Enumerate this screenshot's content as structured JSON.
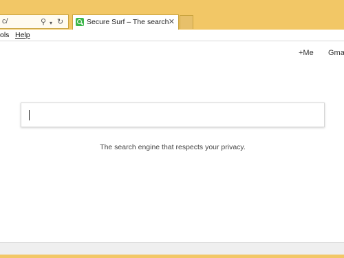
{
  "browser": {
    "address_url": "c/",
    "address_icons": [
      "search-icon",
      "dropdown-arrow-icon",
      "refresh-icon"
    ],
    "tab": {
      "title": "Secure Surf – The search en...",
      "close_glyph": "✕"
    },
    "menu": {
      "tools_partial": "ols",
      "help": "Help"
    }
  },
  "page": {
    "header_links": [
      "+Me",
      "Gma"
    ],
    "search": {
      "value": "",
      "placeholder": ""
    },
    "tagline": "The search engine that respects your privacy."
  },
  "colors": {
    "chrome": "#f2c766",
    "favicon": "#3cb64a",
    "content_bg": "#ffffff"
  }
}
